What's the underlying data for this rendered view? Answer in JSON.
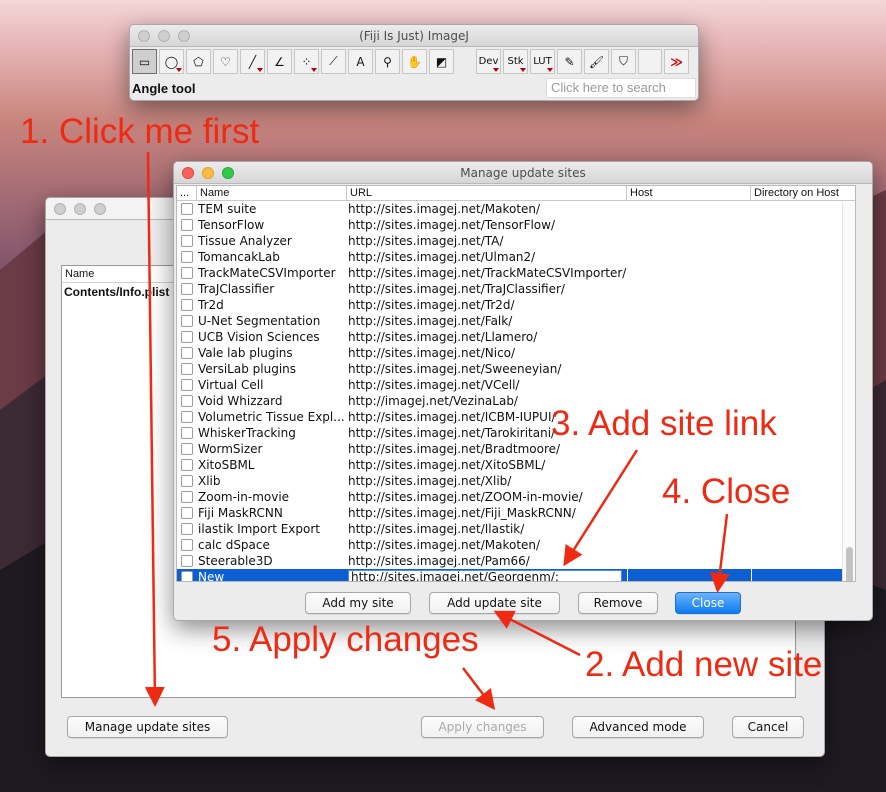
{
  "imagej": {
    "title": "(Fiji Is Just) ImageJ",
    "status": "Angle tool",
    "search_placeholder": "Click here to search",
    "tools": [
      {
        "icon": "rectangle-tool-icon",
        "glyph": "▭",
        "selected": true
      },
      {
        "icon": "oval-tool-icon",
        "glyph": "◯"
      },
      {
        "icon": "polygon-tool-icon",
        "glyph": "⬠"
      },
      {
        "icon": "freehand-tool-icon",
        "glyph": "♡"
      },
      {
        "icon": "line-tool-icon",
        "glyph": "╱"
      },
      {
        "icon": "angle-tool-icon",
        "glyph": "∠"
      },
      {
        "icon": "multipoint-tool-icon",
        "glyph": "⁘"
      },
      {
        "icon": "wand-tool-icon",
        "glyph": "⟋"
      },
      {
        "icon": "text-tool-icon",
        "glyph": "A"
      },
      {
        "icon": "magnifier-tool-icon",
        "glyph": "⚲"
      },
      {
        "icon": "hand-tool-icon",
        "glyph": "✋"
      },
      {
        "icon": "dropper-tool-icon",
        "glyph": "◩"
      }
    ],
    "menu_tools": [
      {
        "icon": "dev-menu-icon",
        "label": "Dev"
      },
      {
        "icon": "stk-menu-icon",
        "label": "Stk"
      },
      {
        "icon": "lut-menu-icon",
        "label": "LUT"
      }
    ],
    "extra_tools": [
      {
        "icon": "pencil-tool-icon",
        "glyph": "✎"
      },
      {
        "icon": "brush-tool-icon",
        "glyph": "🖌"
      },
      {
        "icon": "flood-fill-tool-icon",
        "glyph": "⛉"
      },
      {
        "icon": "blank-tool-icon",
        "glyph": ""
      },
      {
        "icon": "more-tools-icon",
        "glyph": "≫"
      }
    ]
  },
  "updater": {
    "column_name": "Name",
    "first_row": "Contents/Info.plist",
    "buttons": {
      "manage": "Manage update sites",
      "apply": "Apply changes",
      "advanced": "Advanced mode",
      "cancel": "Cancel"
    }
  },
  "manage_sites": {
    "title": "Manage update sites",
    "columns": [
      "...",
      "Name",
      "URL",
      "Host",
      "Directory on Host"
    ],
    "rows": [
      {
        "name": "TEM suite",
        "url": "http://sites.imagej.net/Makoten/"
      },
      {
        "name": "TensorFlow",
        "url": "http://sites.imagej.net/TensorFlow/"
      },
      {
        "name": "Tissue Analyzer",
        "url": "http://sites.imagej.net/TA/"
      },
      {
        "name": "TomancakLab",
        "url": "http://sites.imagej.net/Ulman2/"
      },
      {
        "name": "TrackMateCSVImporter",
        "url": "http://sites.imagej.net/TrackMateCSVImporter/"
      },
      {
        "name": "TraJClassifier",
        "url": "http://sites.imagej.net/TraJClassifier/"
      },
      {
        "name": "Tr2d",
        "url": "http://sites.imagej.net/Tr2d/"
      },
      {
        "name": "U-Net Segmentation",
        "url": "http://sites.imagej.net/Falk/"
      },
      {
        "name": "UCB Vision Sciences",
        "url": "http://sites.imagej.net/Llamero/"
      },
      {
        "name": "Vale lab plugins",
        "url": "http://sites.imagej.net/Nico/"
      },
      {
        "name": "VersiLab plugins",
        "url": "http://sites.imagej.net/Sweeneyian/"
      },
      {
        "name": "Virtual Cell",
        "url": "http://sites.imagej.net/VCell/"
      },
      {
        "name": "Void Whizzard",
        "url": "http://imagej.net/VezinaLab/"
      },
      {
        "name": "Volumetric Tissue Expl...",
        "url": "http://sites.imagej.net/ICBM-IUPUI/"
      },
      {
        "name": "WhiskerTracking",
        "url": "http://sites.imagej.net/Tarokiritani/"
      },
      {
        "name": "WormSizer",
        "url": "http://sites.imagej.net/Bradtmoore/"
      },
      {
        "name": "XitoSBML",
        "url": "http://sites.imagej.net/XitoSBML/"
      },
      {
        "name": "Xlib",
        "url": "http://sites.imagej.net/Xlib/"
      },
      {
        "name": "Zoom-in-movie",
        "url": "http://sites.imagej.net/ZOOM-in-movie/"
      },
      {
        "name": "Fiji MaskRCNN",
        "url": "http://sites.imagej.net/Fiji_MaskRCNN/"
      },
      {
        "name": "ilastik Import Export",
        "url": "http://sites.imagej.net/Ilastik/"
      },
      {
        "name": "calc dSpace",
        "url": "http://sites.imagej.net/Makoten/"
      },
      {
        "name": "Steerable3D",
        "url": "http://sites.imagej.net/Pam66/"
      }
    ],
    "new_row": {
      "name": "New",
      "url": "http://sites.imagej.net/Georgenm/:"
    },
    "buttons": {
      "add_my_site": "Add my site",
      "add_update_site": "Add update site",
      "remove": "Remove",
      "close": "Close"
    }
  },
  "annotations": {
    "a1": "1. Click me first",
    "a2": "2. Add new site",
    "a3": "3. Add site link",
    "a4": "4. Close",
    "a5": "5. Apply changes",
    "color": "#ee2a13"
  }
}
